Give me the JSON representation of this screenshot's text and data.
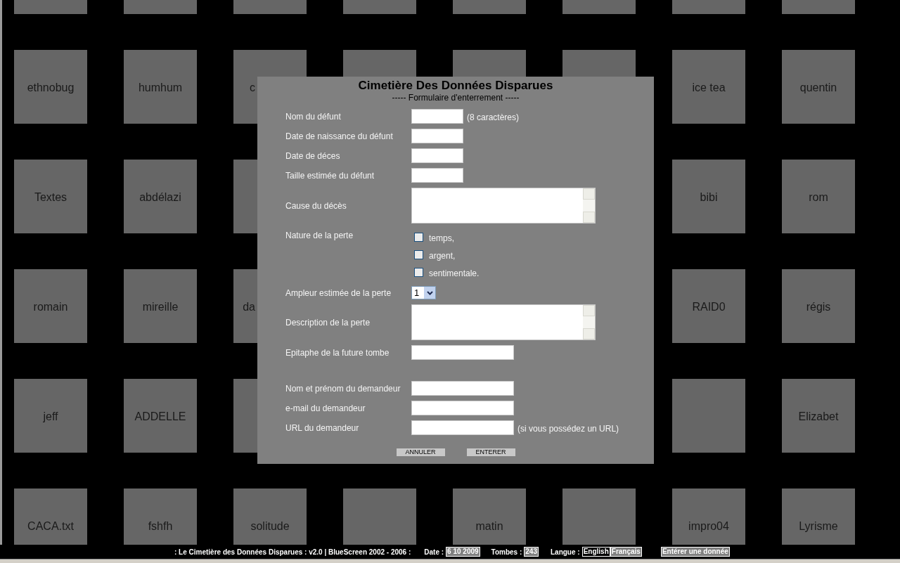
{
  "tiles": [
    {
      "kind": "blank"
    },
    {
      "kind": "blank"
    },
    {
      "kind": "blank"
    },
    {
      "kind": "blank"
    },
    {
      "kind": "blank"
    },
    {
      "kind": "blank"
    },
    {
      "kind": "blank"
    },
    {
      "kind": "blank"
    },
    {
      "kind": "named",
      "label": "ethnobug"
    },
    {
      "kind": "named",
      "label": "humhum"
    },
    {
      "label": "c",
      "kind": "partial"
    },
    {
      "kind": "blank"
    },
    {
      "kind": "blank"
    },
    {
      "kind": "blank"
    },
    {
      "kind": "named",
      "label": "ice tea"
    },
    {
      "kind": "named",
      "label": "quentin"
    },
    {
      "kind": "named",
      "label": "Textes"
    },
    {
      "kind": "named",
      "label": "abdélazi"
    },
    {
      "kind": "blank"
    },
    {
      "kind": "named",
      "label": "bibi"
    },
    {
      "kind": "named",
      "label": "rom"
    },
    {
      "kind": "named",
      "label": "romain"
    },
    {
      "kind": "named",
      "label": "mireille"
    },
    {
      "label": "da",
      "kind": "partial"
    },
    {
      "kind": "named",
      "label": "RAID0"
    },
    {
      "kind": "named",
      "label": "régis"
    },
    {
      "kind": "named",
      "label": "jeff"
    },
    {
      "kind": "named",
      "label": "ADDELLE"
    },
    {
      "kind": "blank"
    },
    {
      "kind": "blank"
    },
    {
      "kind": "named",
      "label": "Elizabet"
    },
    {
      "kind": "named",
      "label": "CACA.txt"
    },
    {
      "kind": "named",
      "label": "fshfh"
    },
    {
      "kind": "named",
      "label": "solitude"
    },
    {
      "kind": "blank"
    },
    {
      "kind": "named",
      "label": "matin"
    },
    {
      "kind": "blank"
    },
    {
      "kind": "named",
      "label": "impro04"
    },
    {
      "kind": "named",
      "label": "Lyrisme"
    }
  ],
  "dialog": {
    "title": "Cimetière Des Données Disparues",
    "subtitle": "----- Formulaire d'enterrement -----",
    "defunt_fields": [
      {
        "kind": "short",
        "label": "Nom du défunt",
        "note": "(8 caractères)"
      },
      {
        "kind": "short",
        "label": "Date de naissance du défunt"
      },
      {
        "kind": "short",
        "label": "Date de déces"
      },
      {
        "kind": "short",
        "label": "Taille estimée du défunt"
      },
      {
        "kind": "textarea",
        "label": "Cause du décès"
      },
      {
        "kind": "checkboxes",
        "label": "Nature de la perte",
        "options": [
          {
            "label": "temps,",
            "checked": false
          },
          {
            "label": "argent,",
            "checked": false
          },
          {
            "label": "sentimentale.",
            "checked": false
          }
        ]
      },
      {
        "kind": "select",
        "label": "Ampleur estimée de la perte",
        "value": "1"
      },
      {
        "kind": "textarea",
        "label": "Description de la perte"
      },
      {
        "kind": "long",
        "label": "Epitaphe de la future tombe"
      }
    ],
    "demandeur_fields": [
      {
        "kind": "long",
        "label": "Nom et prénom du demandeur"
      },
      {
        "kind": "long",
        "label": "e-mail du demandeur"
      },
      {
        "kind": "long",
        "label": "URL du demandeur",
        "note": "(si vous possédez un URL)"
      }
    ],
    "buttons": [
      "ANNULER",
      "ENTERER"
    ]
  },
  "footer": {
    "credit": ": Le Cimetière des Données Disparues : v2.0 | BlueScreen 2002 - 2006 :",
    "date_label": "Date :",
    "date": "6 10 2009",
    "tombs_label": "Tombes :",
    "tombs": "243",
    "language_label": "Langue :",
    "languages": [
      {
        "label": "English",
        "selected": true
      },
      {
        "label": "Français",
        "selected": false
      }
    ],
    "action": "Entérer une donnée"
  }
}
